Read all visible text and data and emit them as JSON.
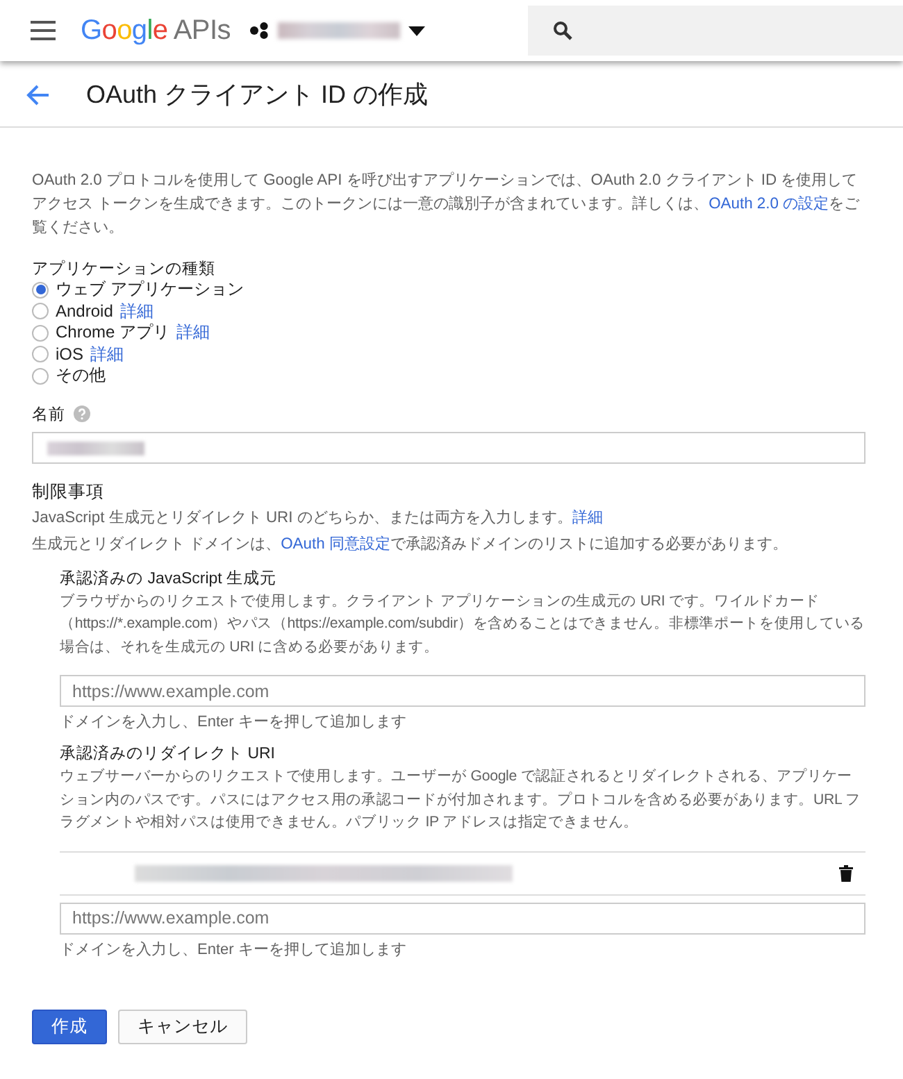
{
  "header": {
    "product": "Google APIs"
  },
  "page_title": "OAuth クライアント ID の作成",
  "intro": [
    {
      "kind": "text",
      "text": "OAuth 2.0 プロトコルを使用して Google API を呼び出すアプリケーションでは、OAuth 2.0 クライアント ID を使用してアクセス トークンを生成できます。このトークンには一意の識別子が含まれています。詳しくは、"
    },
    {
      "kind": "link",
      "text": "OAuth 2.0 の設定"
    },
    {
      "kind": "text",
      "text": "をご覧ください。"
    }
  ],
  "application_type": {
    "label": "アプリケーションの種類",
    "options": [
      {
        "label": "ウェブ アプリケーション",
        "selected": true
      },
      {
        "label": "Android",
        "link": "詳細",
        "selected": false
      },
      {
        "label": "Chrome アプリ",
        "link": "詳細",
        "selected": false
      },
      {
        "label": "iOS",
        "link": "詳細",
        "selected": false
      },
      {
        "label": "その他",
        "selected": false
      }
    ]
  },
  "name_field": {
    "label": "名前"
  },
  "restrictions": {
    "title": "制限事項",
    "lines": [
      [
        {
          "kind": "text",
          "text": "JavaScript 生成元とリダイレクト URI のどちらか、または両方を入力します。"
        },
        {
          "kind": "link",
          "text": "詳細"
        }
      ],
      [
        {
          "kind": "text",
          "text": "生成元とリダイレクト ドメインは、"
        },
        {
          "kind": "link",
          "text": "OAuth 同意設定"
        },
        {
          "kind": "text",
          "text": "で承認済みドメインのリストに追加する必要があります。"
        }
      ]
    ],
    "sections": [
      {
        "title": "承認済みの JavaScript 生成元",
        "description": "ブラウザからのリクエストで使用します。クライアント アプリケーションの生成元の URI です。ワイルドカード（https://*.example.com）やパス（https://example.com/subdir）を含めることはできません。非標準ポートを使用している場合は、それを生成元の URI に含める必要があります。",
        "placeholder": "https://www.example.com",
        "hint": "ドメインを入力し、Enter キーを押して追加します"
      },
      {
        "title": "承認済みのリダイレクト URI",
        "description": "ウェブサーバーからのリクエストで使用します。ユーザーが Google で認証されるとリダイレクトされる、アプリケーション内のパスです。パスにはアクセス用の承認コードが付加されます。プロトコルを含める必要があります。URL フラグメントや相対パスは使用できません。パブリック IP アドレスは指定できません。",
        "entries": [
          {
            "kind": "redacted"
          }
        ],
        "placeholder": "https://www.example.com",
        "hint": "ドメインを入力し、Enter キーを押して追加します"
      }
    ]
  },
  "buttons": [
    {
      "primary": true,
      "label": "作成"
    },
    {
      "primary": false,
      "label": "キャンセル"
    }
  ]
}
